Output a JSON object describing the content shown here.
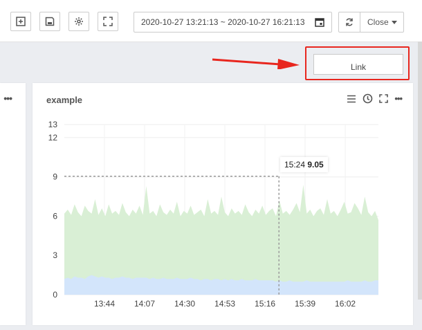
{
  "toolbar": {
    "time_range": "2020-10-27 13:21:13 ~ 2020-10-27 16:21:13",
    "close_label": "Close",
    "link_label": "Link"
  },
  "panel": {
    "title": "example",
    "tooltip_time": "15:24",
    "tooltip_value": "9.05"
  },
  "icons": [
    "add-panel-icon",
    "save-icon",
    "gear-icon",
    "fullscreen-icon",
    "calendar-icon",
    "refresh-icon",
    "menu-icon",
    "clock-icon",
    "expand-icon",
    "more-icon"
  ],
  "colors": {
    "area_green": "#d9efd5",
    "area_blue": "#d3e5fb",
    "highlight_red": "#e8261e"
  },
  "chart_data": {
    "type": "area",
    "x_ticks": [
      "13:44",
      "14:07",
      "14:30",
      "14:53",
      "15:16",
      "15:39",
      "16:02"
    ],
    "y_ticks": [
      0,
      3,
      6,
      9,
      12,
      13
    ],
    "ylim": [
      0,
      13
    ],
    "xlim": [
      "13:21",
      "16:21"
    ],
    "grid": true,
    "series": [
      {
        "values": [
          6.2,
          6.5,
          6.1,
          6.9,
          6.3,
          6.0,
          6.8,
          6.4,
          6.2,
          7.3,
          6.1,
          6.6,
          6.0,
          6.9,
          6.2,
          6.4,
          6.1,
          7.0,
          6.3,
          6.0,
          6.5,
          6.2,
          6.8,
          6.1,
          8.3,
          6.2,
          6.4,
          6.0,
          6.9,
          6.3,
          6.1,
          6.5,
          6.2,
          7.1,
          6.0,
          6.4,
          6.2,
          6.8,
          6.1,
          6.3,
          6.5,
          6.0,
          7.3,
          6.2,
          6.4,
          6.1,
          7.5,
          6.3,
          6.0,
          6.6,
          6.2,
          6.4,
          6.1,
          6.9,
          6.3,
          6.0,
          6.5,
          6.2,
          6.8,
          6.1,
          6.4,
          6.6,
          6.0,
          7.2,
          6.2,
          6.4,
          6.1,
          6.5,
          7.0,
          6.3,
          8.4,
          6.2,
          6.5,
          6.0,
          6.4,
          6.6,
          6.1,
          7.3,
          6.2,
          6.4,
          6.0,
          6.5,
          7.1,
          6.2,
          6.3,
          7.0,
          6.6,
          6.1,
          7.5,
          6.3,
          6.0,
          6.4,
          5.7
        ]
      },
      {
        "values": [
          1.2,
          1.3,
          1.2,
          1.4,
          1.3,
          1.3,
          1.2,
          1.4,
          1.5,
          1.4,
          1.3,
          1.4,
          1.3,
          1.3,
          1.2,
          1.3,
          1.3,
          1.4,
          1.3,
          1.3,
          1.2,
          1.3,
          1.3,
          1.3,
          1.3,
          1.2,
          1.3,
          1.2,
          1.2,
          1.3,
          1.2,
          1.2,
          1.2,
          1.3,
          1.2,
          1.2,
          1.2,
          1.3,
          1.2,
          1.2,
          1.1,
          1.2,
          1.2,
          1.1,
          1.2,
          1.2,
          1.1,
          1.2,
          1.1,
          1.2,
          1.1,
          1.1,
          1.2,
          1.1,
          1.1,
          1.1,
          1.2,
          1.1,
          1.1,
          1.1,
          1.1,
          1.1,
          1.0,
          1.1,
          1.0,
          1.0,
          1.1,
          1.0,
          1.0,
          1.0,
          1.0,
          1.1,
          1.0,
          1.0,
          1.0,
          1.0,
          1.0,
          1.0,
          1.0,
          1.0,
          1.0,
          1.0,
          1.0,
          1.1,
          1.0,
          1.0,
          1.0,
          1.0,
          1.1,
          1.0,
          1.0,
          1.1,
          1.1
        ]
      }
    ],
    "marker": {
      "x": "15:24",
      "y": 9.05
    }
  }
}
